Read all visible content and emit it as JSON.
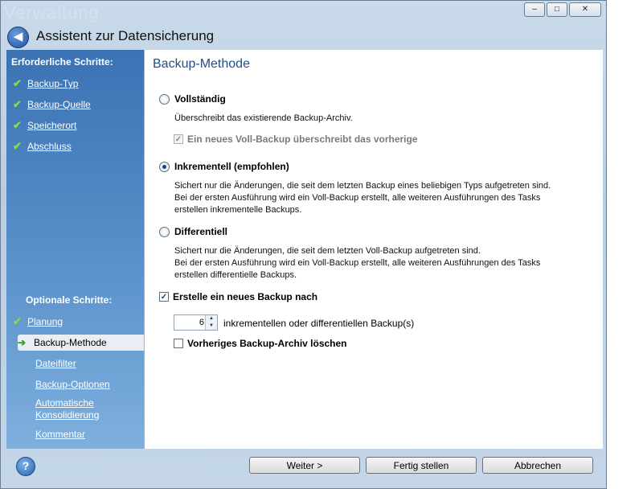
{
  "window": {
    "background_title": "Verwaltung",
    "title": "Assistent zur Datensicherung",
    "controls": [
      "–",
      "□",
      "✕"
    ]
  },
  "sidebar": {
    "required_heading": "Erforderliche Schritte:",
    "required_items": [
      "Backup-Typ",
      "Backup-Quelle",
      "Speicherort",
      "Abschluss"
    ],
    "optional_heading": "Optionale Schritte:",
    "optional_items": [
      "Planung",
      "Backup-Methode",
      "Dateifilter",
      "Backup-Optionen",
      "Automatische Konsolidierung",
      "Kommentar"
    ]
  },
  "main": {
    "page_title": "Backup-Methode",
    "full": {
      "label": "Vollständig",
      "desc": "Überschreibt das existierende Backup-Archiv.",
      "sub_option": "Ein neues Voll-Backup überschreibt das vorherige"
    },
    "incremental": {
      "label": "Inkrementell (empfohlen)",
      "desc_lines": [
        "Sichert nur die Änderungen, die seit dem letzten Backup eines beliebigen Typs aufgetreten sind.",
        "Bei der ersten Ausführung wird ein Voll-Backup erstellt, alle weiteren Ausführungen des Tasks",
        "erstellen inkrementelle Backups."
      ]
    },
    "differential": {
      "label": "Differentiell",
      "desc_lines": [
        "Sichert nur die Änderungen, die seit dem letzten Voll-Backup aufgetreten sind.",
        "Bei der ersten Ausführung wird ein Voll-Backup erstellt, alle weiteren Ausführungen des Tasks",
        "erstellen differentielle Backups."
      ]
    },
    "new_backup": {
      "label": "Erstelle ein neues Backup nach",
      "count": "6",
      "count_label": "inkrementellen oder differentiellen Backup(s)",
      "delete_label": "Vorheriges Backup-Archiv löschen"
    }
  },
  "footer": {
    "next": "Weiter >",
    "finish": "Fertig stellen",
    "cancel": "Abbrechen"
  }
}
